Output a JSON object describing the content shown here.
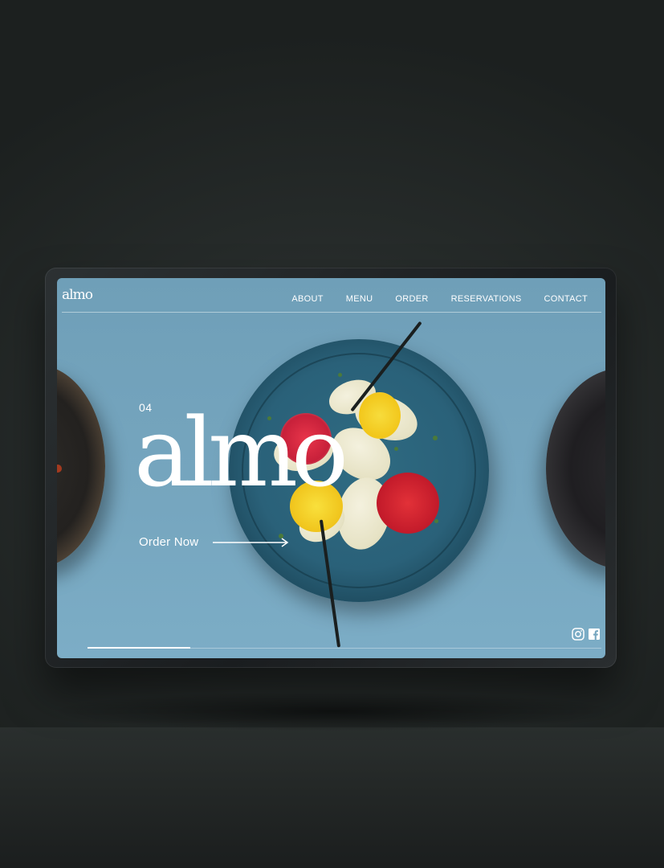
{
  "brand": {
    "logo_text": "almo",
    "hero_title": "almo"
  },
  "nav": {
    "items": [
      {
        "label": "ABOUT"
      },
      {
        "label": "MENU"
      },
      {
        "label": "ORDER"
      },
      {
        "label": "RESERVATIONS"
      },
      {
        "label": "CONTACT"
      }
    ]
  },
  "hero": {
    "slide_number": "04",
    "cta_label": "Order Now"
  },
  "slider": {
    "progress_fraction": 0.2
  },
  "social": {
    "icons": [
      "instagram-icon",
      "facebook-icon"
    ]
  },
  "colors": {
    "screen_background": "#76a6bf",
    "text": "#ffffff",
    "backdrop": "#262b2a"
  }
}
